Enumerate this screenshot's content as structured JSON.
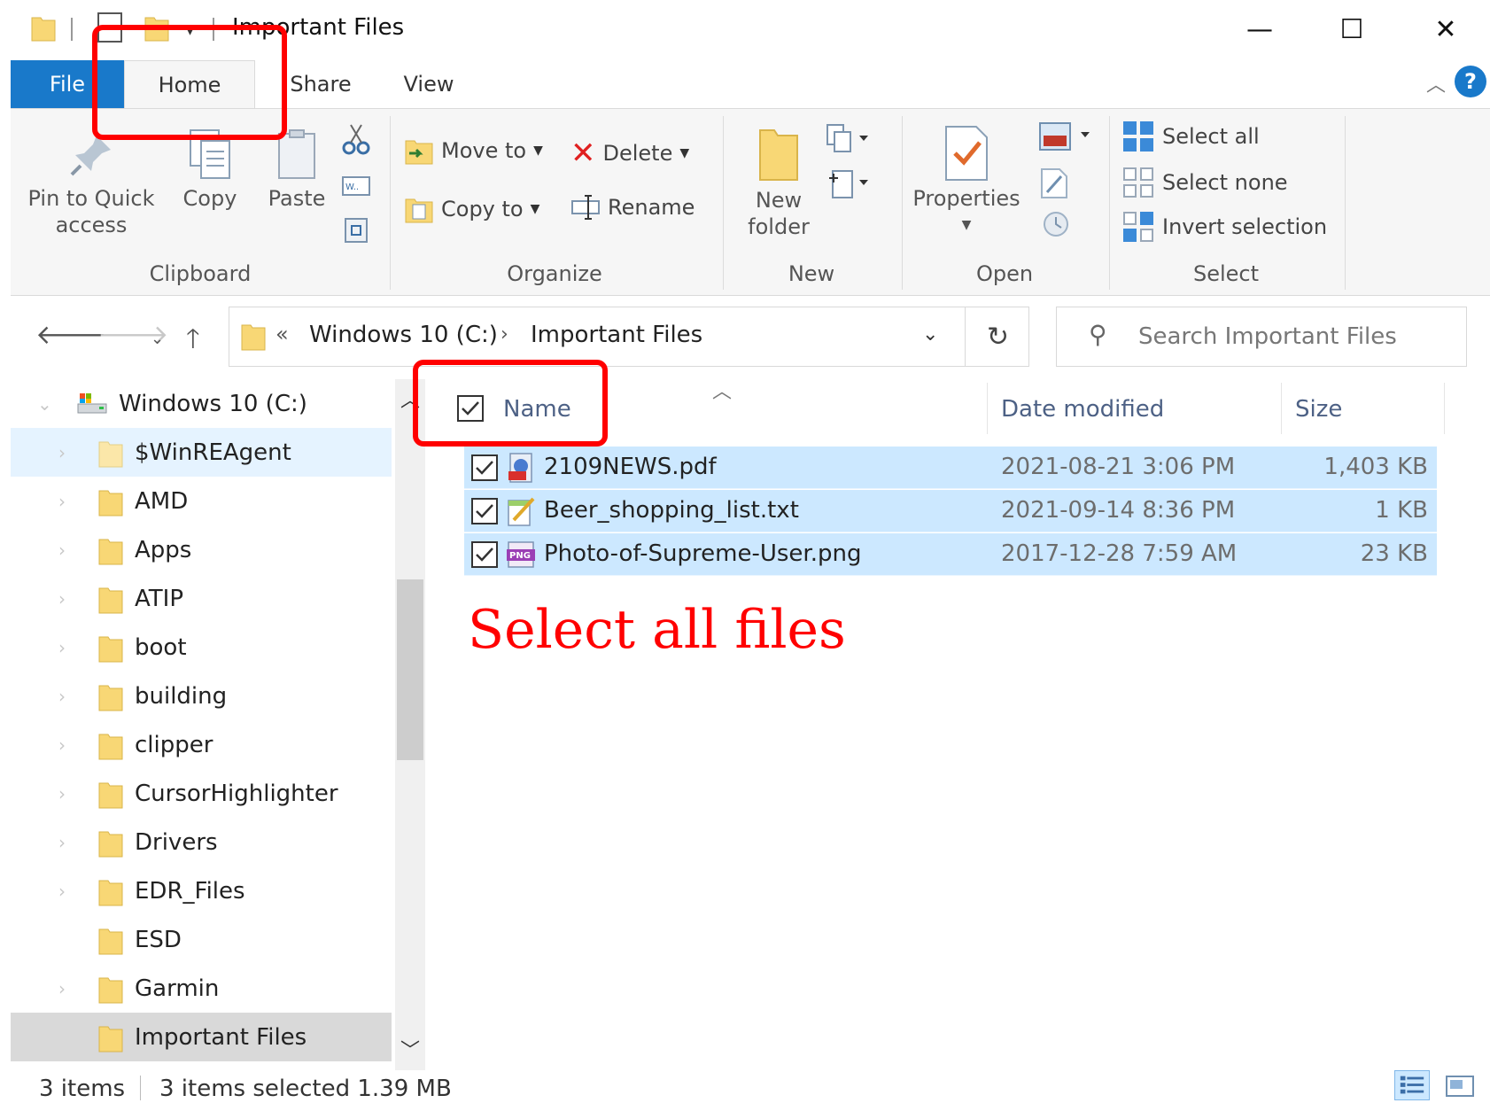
{
  "window": {
    "title": "Important Files",
    "minimize_glyph": "—",
    "maximize_glyph": "☐",
    "close_glyph": "✕"
  },
  "tabs": {
    "file": "File",
    "home": "Home",
    "share": "Share",
    "view": "View"
  },
  "ribbon": {
    "clipboard": {
      "label": "Clipboard",
      "pin": "Pin to Quick",
      "pin2": "access",
      "copy": "Copy",
      "paste": "Paste"
    },
    "organize": {
      "label": "Organize",
      "move_to": "Move to",
      "copy_to": "Copy to",
      "delete": "Delete",
      "rename": "Rename"
    },
    "new": {
      "label": "New",
      "new_folder": "New",
      "new_folder2": "folder"
    },
    "open": {
      "label": "Open",
      "properties": "Properties"
    },
    "select": {
      "label": "Select",
      "select_all": "Select all",
      "select_none": "Select none",
      "invert": "Invert selection"
    }
  },
  "address": {
    "chevron": "«",
    "crumb1": "Windows 10 (C:)",
    "separator": "›",
    "crumb2": "Important Files"
  },
  "search": {
    "placeholder": "Search Important Files"
  },
  "navpane": {
    "root": "Windows 10 (C:)",
    "items": [
      "$WinREAgent",
      "AMD",
      "Apps",
      "ATIP",
      "boot",
      "building",
      "clipper",
      "CursorHighlighter",
      "Drivers",
      "EDR_Files",
      "ESD",
      "Garmin",
      "Important Files"
    ]
  },
  "columns": {
    "name": "Name",
    "date": "Date modified",
    "size": "Size"
  },
  "files": [
    {
      "name": "2109NEWS.pdf",
      "date": "2021-08-21 3:06 PM",
      "size": "1,403 KB",
      "icon": "pdf-file-icon"
    },
    {
      "name": "Beer_shopping_list.txt",
      "date": "2021-09-14 8:36 PM",
      "size": "1 KB",
      "icon": "text-file-icon"
    },
    {
      "name": "Photo-of-Supreme-User.png",
      "date": "2017-12-28 7:59 AM",
      "size": "23 KB",
      "icon": "png-file-icon"
    }
  ],
  "annotation": {
    "text": "Select all files",
    "color": "#ff0000"
  },
  "status": {
    "count": "3 items",
    "selected": "3 items selected  1.39 MB"
  },
  "colors": {
    "accent": "#1979ca",
    "selection": "#cce8ff",
    "folder": "#f8d775"
  }
}
